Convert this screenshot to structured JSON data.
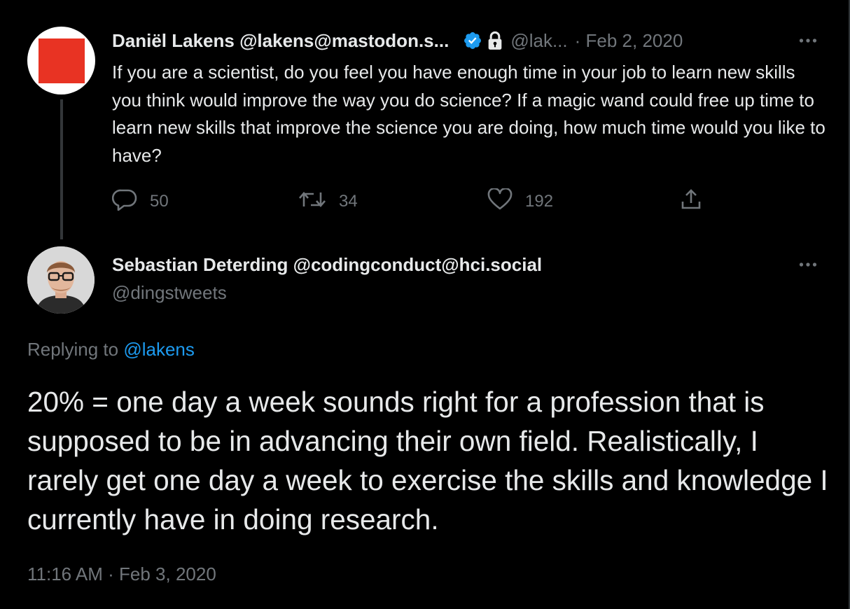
{
  "parent_tweet": {
    "author_name": "Daniël Lakens @lakens@mastodon.s...",
    "handle": "@lak...",
    "date": "· Feb 2, 2020",
    "verified_icon": "verified-badge-icon",
    "protected_icon": "lock-icon",
    "text": "If you are a scientist, do you feel you have enough time in your job to learn new skills you think would improve the way you do science? If a magic wand could free up time to learn new skills that improve the science you are doing, how much time would you like to have?",
    "stats": {
      "replies": "50",
      "retweets": "34",
      "likes": "192"
    }
  },
  "reply_tweet": {
    "author_name": "Sebastian Deterding @codingconduct@hci.social",
    "handle": "@dingstweets",
    "replying_to_label": "Replying to ",
    "replying_to_handle": "@lakens",
    "text": "20% = one day a week sounds right for a profession that is supposed to be in advancing their own field. Realistically, I rarely get one day a week to exercise the skills and knowledge I currently have in doing research.",
    "timestamp": "11:16 AM · Feb 3, 2020"
  },
  "colors": {
    "background": "#000000",
    "text_primary": "#e7e9ea",
    "text_secondary": "#71767b",
    "accent": "#1d9bf0",
    "avatar_red": "#e83323"
  }
}
